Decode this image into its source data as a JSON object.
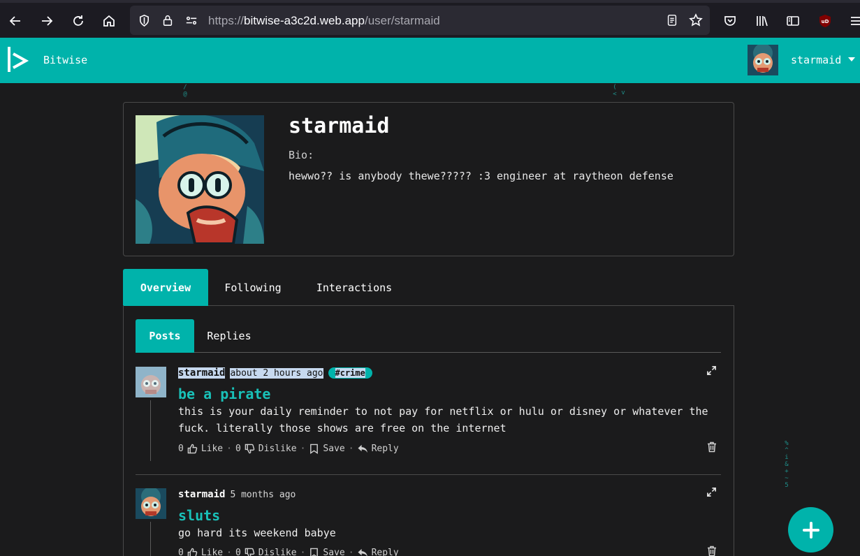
{
  "browser": {
    "url_prefix": "https://",
    "url_host": "bitwise-a3c2d.web.app",
    "url_path": "/user/starmaid"
  },
  "header": {
    "brand": "Bitwise",
    "username": "starmaid",
    "accent_color": "#00b3ab"
  },
  "profile": {
    "name": "starmaid",
    "bio_label": "Bio:",
    "bio": "hewwo?? is anybody thewe????? :3 engineer at raytheon defense"
  },
  "tabs": [
    {
      "label": "Overview",
      "active": true
    },
    {
      "label": "Following",
      "active": false
    },
    {
      "label": "Interactions",
      "active": false
    }
  ],
  "subtabs": [
    {
      "label": "Posts",
      "active": true
    },
    {
      "label": "Replies",
      "active": false
    }
  ],
  "posts": [
    {
      "author": "starmaid",
      "time": "about 2 hours ago",
      "tag": "#crime",
      "title": "be a pirate",
      "body": "this is your daily reminder to not pay for netflix or hulu or disney or whatever the fuck. literally those shows are free on the internet",
      "likes": "0",
      "like_label": "Like",
      "dislikes": "0",
      "dislike_label": "Dislike",
      "save_label": "Save",
      "reply_label": "Reply"
    },
    {
      "author": "starmaid",
      "time": "5 months ago",
      "title": "sluts",
      "body": "go hard its weekend babye",
      "likes": "0",
      "like_label": "Like",
      "dislikes": "0",
      "dislike_label": "Dislike",
      "save_label": "Save",
      "reply_label": "Reply"
    }
  ],
  "actions": {
    "separator": "·"
  }
}
